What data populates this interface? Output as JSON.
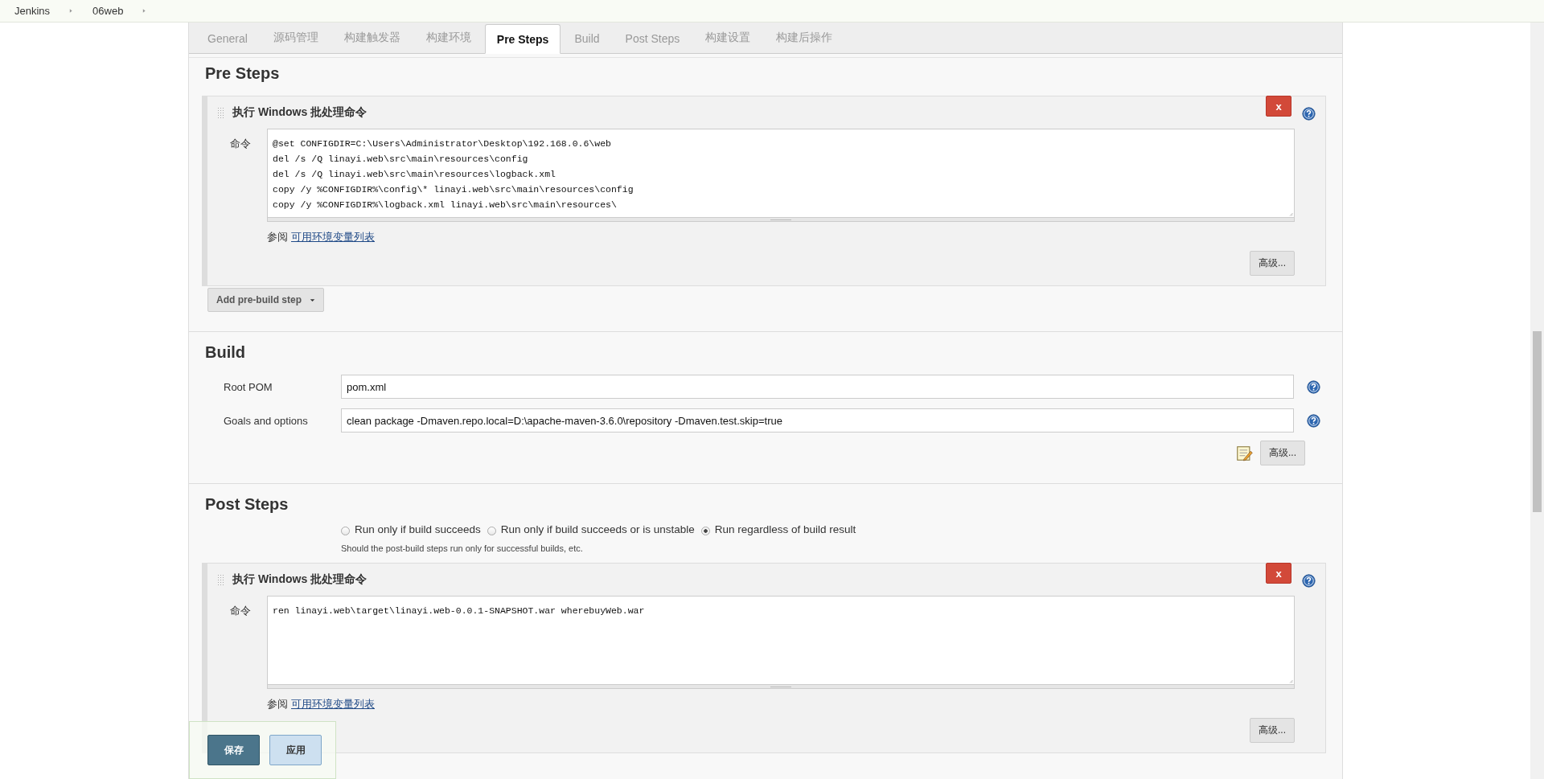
{
  "breadcrumbs": [
    "Jenkins",
    "06web"
  ],
  "tabs": [
    {
      "label": "General",
      "selected": false
    },
    {
      "label": "源码管理",
      "selected": false
    },
    {
      "label": "构建触发器",
      "selected": false
    },
    {
      "label": "构建环境",
      "selected": false
    },
    {
      "label": "Pre Steps",
      "selected": true
    },
    {
      "label": "Build",
      "selected": false
    },
    {
      "label": "Post Steps",
      "selected": false
    },
    {
      "label": "构建设置",
      "selected": false
    },
    {
      "label": "构建后操作",
      "selected": false
    }
  ],
  "pre_steps": {
    "title": "Pre Steps",
    "steps": [
      {
        "title": "执行 Windows 批处理命令",
        "delete_button": "x",
        "command_label": "命令",
        "command": "@set CONFIGDIR=C:\\Users\\Administrator\\Desktop\\192.168.0.6\\web\ndel /s /Q linayi.web\\src\\main\\resources\\config\ndel /s /Q linayi.web\\src\\main\\resources\\logback.xml\ncopy /y %CONFIGDIR%\\config\\* linayi.web\\src\\main\\resources\\config\ncopy /y %CONFIGDIR%\\logback.xml linayi.web\\src\\main\\resources\\",
        "see_also": "参阅",
        "see_also_link": "可用环境变量列表",
        "advanced_button": "高级..."
      }
    ],
    "add_button": "Add pre-build step"
  },
  "build": {
    "title": "Build",
    "fields": [
      {
        "label": "Root POM",
        "value": "pom.xml"
      },
      {
        "label": "Goals and options",
        "value": "clean package -Dmaven.repo.local=D:\\apache-maven-3.6.0\\repository -Dmaven.test.skip=true"
      }
    ],
    "advanced_button": "高级..."
  },
  "post_steps": {
    "title": "Post Steps",
    "options": [
      {
        "label": "Run only if build succeeds",
        "selected": false
      },
      {
        "label": "Run only if build succeeds or is unstable",
        "selected": false
      },
      {
        "label": "Run regardless of build result",
        "selected": true
      }
    ],
    "hint": "Should the post-build steps run only for successful builds, etc.",
    "steps": [
      {
        "title": "执行 Windows 批处理命令",
        "delete_button": "x",
        "command_label": "命令",
        "command": "ren linayi.web\\target\\linayi.web-0.0.1-SNAPSHOT.war wherebuyWeb.war",
        "see_also": "参阅",
        "see_also_link": "可用环境变量列表",
        "advanced_button": "高级..."
      }
    ]
  },
  "save_bar": {
    "buttons": [
      {
        "label": "保存",
        "kind": "primary"
      },
      {
        "label": "应用",
        "kind": "secondary"
      }
    ]
  }
}
